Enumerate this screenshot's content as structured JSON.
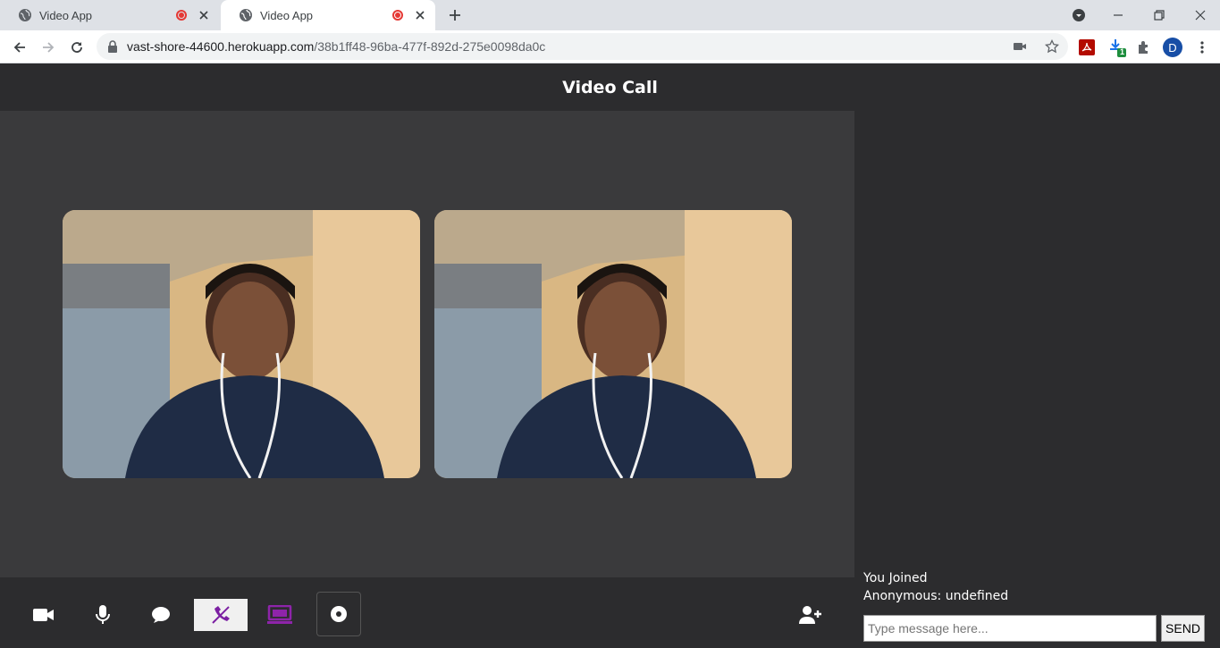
{
  "browser": {
    "tabs": [
      {
        "title": "Video App",
        "active": false
      },
      {
        "title": "Video App",
        "active": true
      }
    ],
    "url_host": "vast-shore-44600.herokuapp.com",
    "url_path": "/38b1ff48-96ba-477f-892d-275e0098da0c",
    "profile_initial": "D",
    "download_badge": "1"
  },
  "app": {
    "title": "Video Call"
  },
  "videos": [
    {
      "label": "local-video"
    },
    {
      "label": "remote-video"
    }
  ],
  "controls": {
    "icons": [
      "camera-icon",
      "microphone-icon",
      "chat-icon",
      "end-call-icon",
      "screen-share-icon",
      "record-icon",
      "add-user-icon"
    ],
    "accent_color": "#7b1fa2"
  },
  "chat": {
    "messages": [
      "You Joined",
      "Anonymous: undefined"
    ],
    "input_placeholder": "Type message here...",
    "send_label": "SEND"
  }
}
